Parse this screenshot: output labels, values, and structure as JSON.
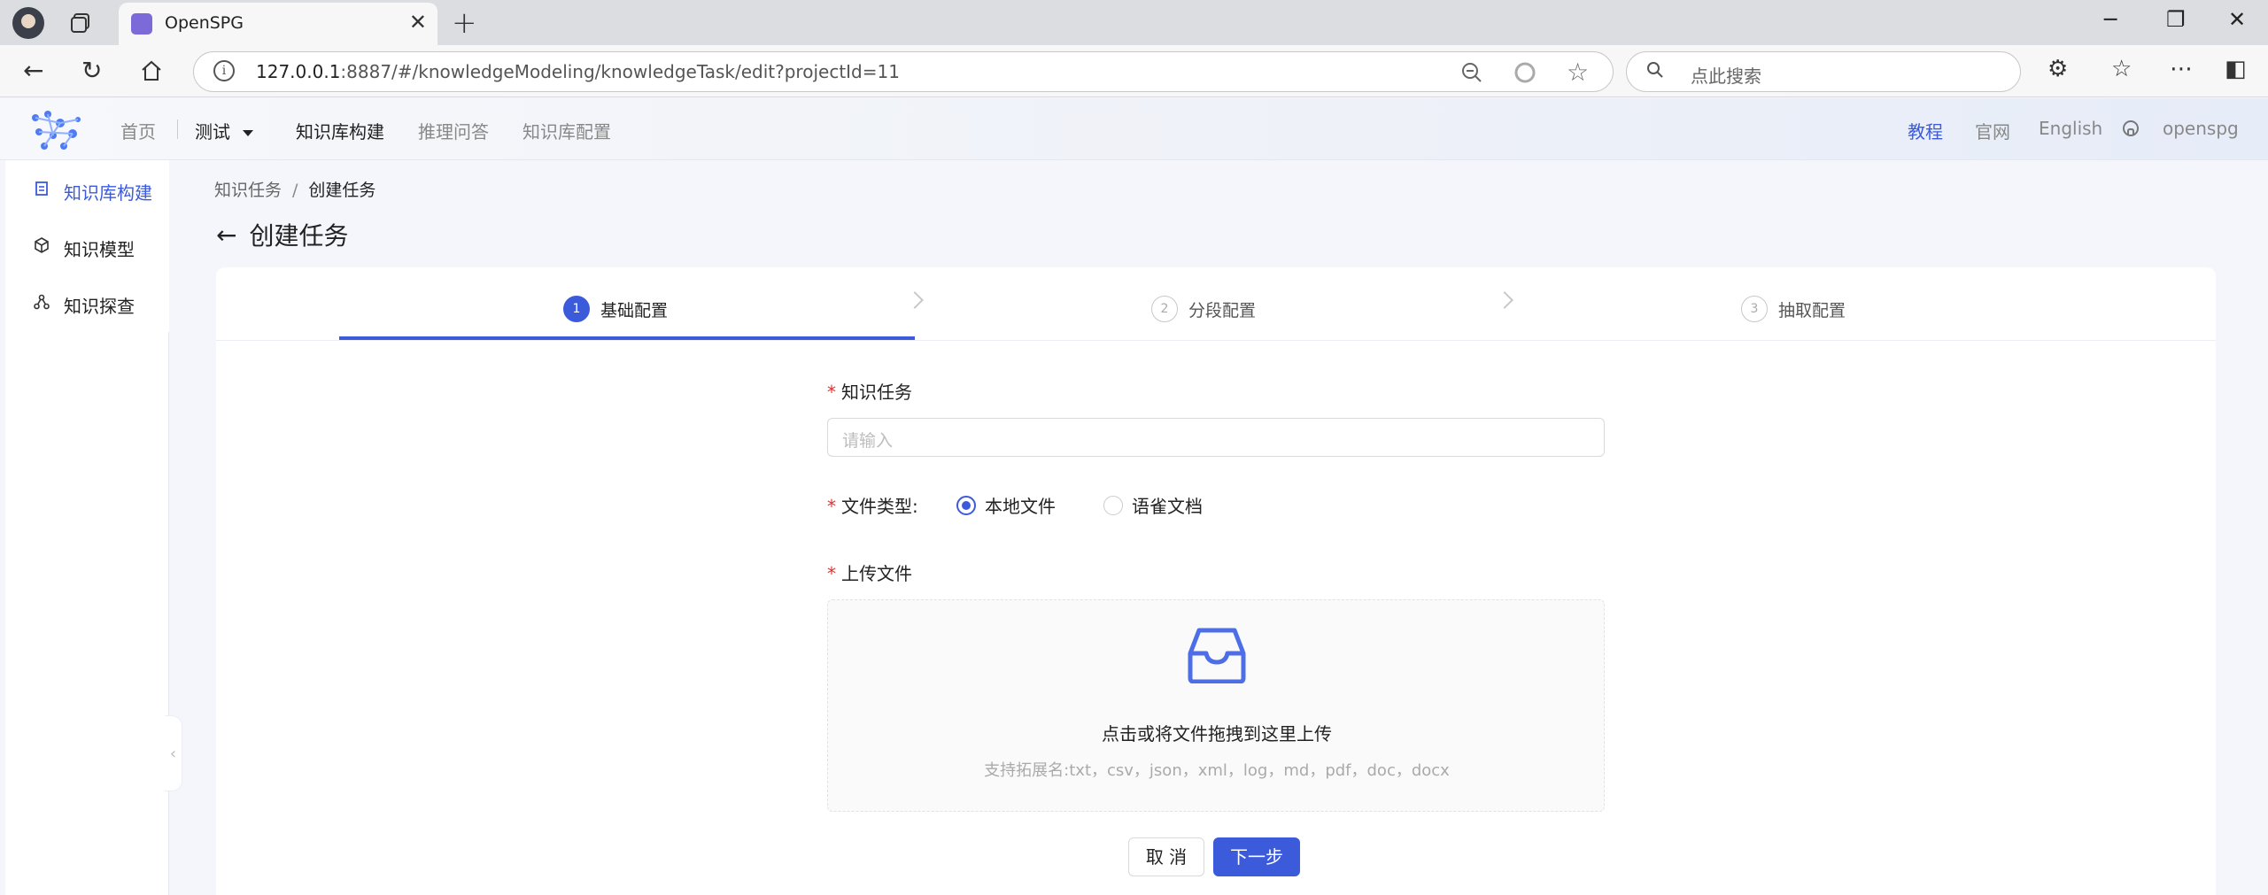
{
  "browser": {
    "tab_title": "OpenSPG",
    "url_host": "127.0.0.1",
    "url_rest": ":8887/#/knowledgeModeling/knowledgeTask/edit?projectId=11",
    "search_placeholder": "点此搜索"
  },
  "header": {
    "nav": [
      "首页",
      "测试",
      "知识库构建",
      "推理问答",
      "知识库配置"
    ],
    "right": [
      "教程",
      "官网",
      "English",
      "openspg"
    ]
  },
  "sidebar": {
    "items": [
      {
        "label": "知识库构建",
        "icon": "document-icon"
      },
      {
        "label": "知识模型",
        "icon": "cube-icon"
      },
      {
        "label": "知识探查",
        "icon": "graph-icon"
      }
    ],
    "collapse_glyph": "‹"
  },
  "breadcrumb": {
    "parent": "知识任务",
    "sep": "/",
    "current": "创建任务"
  },
  "page_title": "创建任务",
  "steps": [
    {
      "num": "1",
      "label": "基础配置"
    },
    {
      "num": "2",
      "label": "分段配置"
    },
    {
      "num": "3",
      "label": "抽取配置"
    }
  ],
  "form": {
    "task_label": "知识任务",
    "task_placeholder": "请输入",
    "filetype_label": "文件类型:",
    "filetype_options": [
      "本地文件",
      "语雀文档"
    ],
    "upload_label": "上传文件",
    "upload_main": "点击或将文件拖拽到这里上传",
    "upload_hint": "支持拓展名:txt，csv，json，xml，log，md，pdf，doc，docx",
    "required_mark": "*"
  },
  "buttons": {
    "cancel": "取 消",
    "next": "下一步"
  },
  "colors": {
    "primary": "#3b5bdb",
    "required": "#e03131"
  }
}
